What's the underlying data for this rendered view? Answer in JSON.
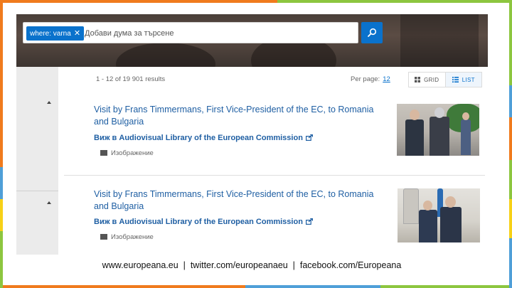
{
  "search": {
    "chip_label": "where: varna",
    "chip_remove": "✕",
    "placeholder": "Добави дума за търсене"
  },
  "results": {
    "count_text": "1 - 12 of 19 901 results",
    "per_page_label": "Per page:",
    "per_page_value": "12",
    "view_grid_label": "GRID",
    "view_list_label": "LIST",
    "active_view": "list"
  },
  "items": [
    {
      "title": "Visit by Frans Timmermans, First Vice-President of the EC, to Romania and Bulgaria",
      "link_text": "Виж в Audiovisual Library of the European Commission",
      "type_label": "Изображение"
    },
    {
      "title": "Visit by Frans Timmermans, First Vice-President of the EC, to Romania and Bulgaria",
      "link_text": "Виж в Audiovisual Library of the European Commission",
      "type_label": "Изображение"
    }
  ],
  "footer": {
    "text": "www.europeana.eu  |  twitter.com/europeanaeu  |  facebook.com/Europeana"
  },
  "colors": {
    "accent": "#0a72cc",
    "link": "#1f5fa3",
    "frame_orange": "#f07b1d",
    "frame_green": "#8dc63f",
    "frame_blue": "#4f9fd8",
    "frame_yellow": "#f7d117"
  }
}
